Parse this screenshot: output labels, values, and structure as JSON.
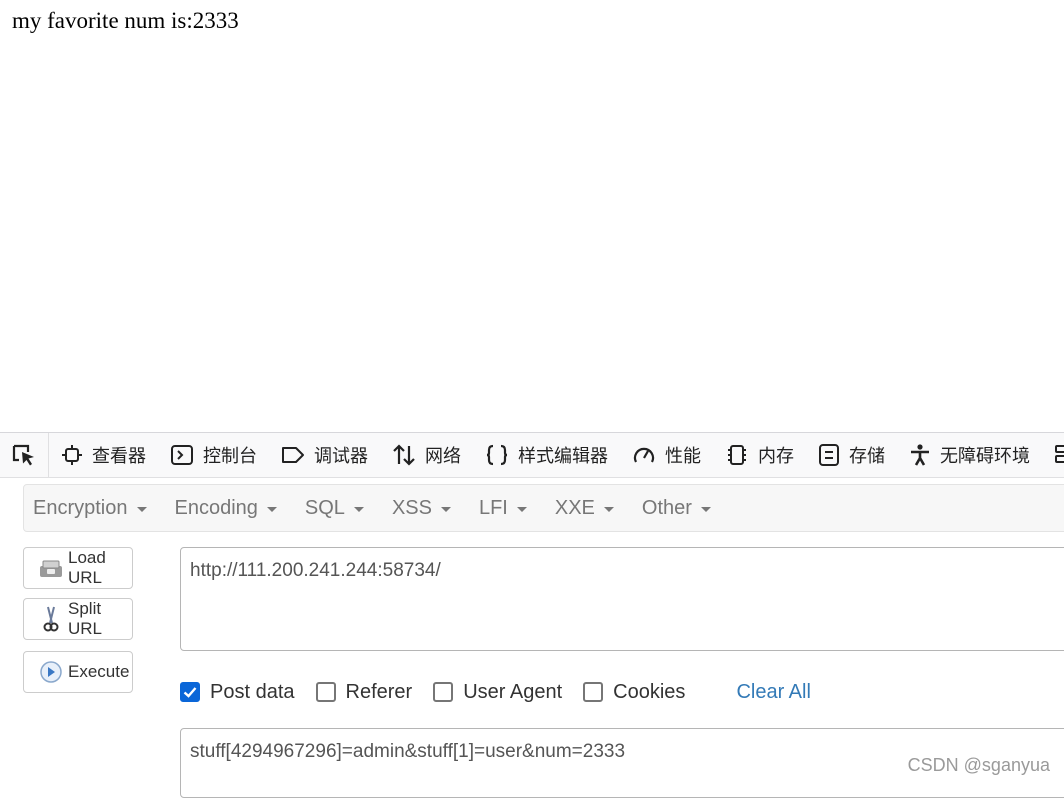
{
  "page": {
    "text": "my favorite num is:2333"
  },
  "devtools": {
    "tabs": [
      {
        "label": "查看器",
        "icon": "inspector-icon"
      },
      {
        "label": "控制台",
        "icon": "console-icon"
      },
      {
        "label": "调试器",
        "icon": "debugger-icon"
      },
      {
        "label": "网络",
        "icon": "network-icon"
      },
      {
        "label": "样式编辑器",
        "icon": "style-editor-icon"
      },
      {
        "label": "性能",
        "icon": "performance-icon"
      },
      {
        "label": "内存",
        "icon": "memory-icon"
      },
      {
        "label": "存储",
        "icon": "storage-icon"
      },
      {
        "label": "无障碍环境",
        "icon": "accessibility-icon"
      }
    ]
  },
  "hackbar": {
    "menu": [
      "Encryption",
      "Encoding",
      "SQL",
      "XSS",
      "LFI",
      "XXE",
      "Other"
    ],
    "buttons": {
      "load": "Load URL",
      "split": "Split URL",
      "execute": "Execute"
    },
    "url": "http://111.200.241.244:58734/",
    "options": {
      "post": "Post data",
      "referer": "Referer",
      "user_agent": "User Agent",
      "cookies": "Cookies",
      "clear_all": "Clear All"
    },
    "post_body": "stuff[4294967296]=admin&stuff[1]=user&num=2333"
  },
  "watermark": "CSDN @sganyua",
  "colors": {
    "accent": "#0a66d8",
    "link": "#337ab7"
  }
}
